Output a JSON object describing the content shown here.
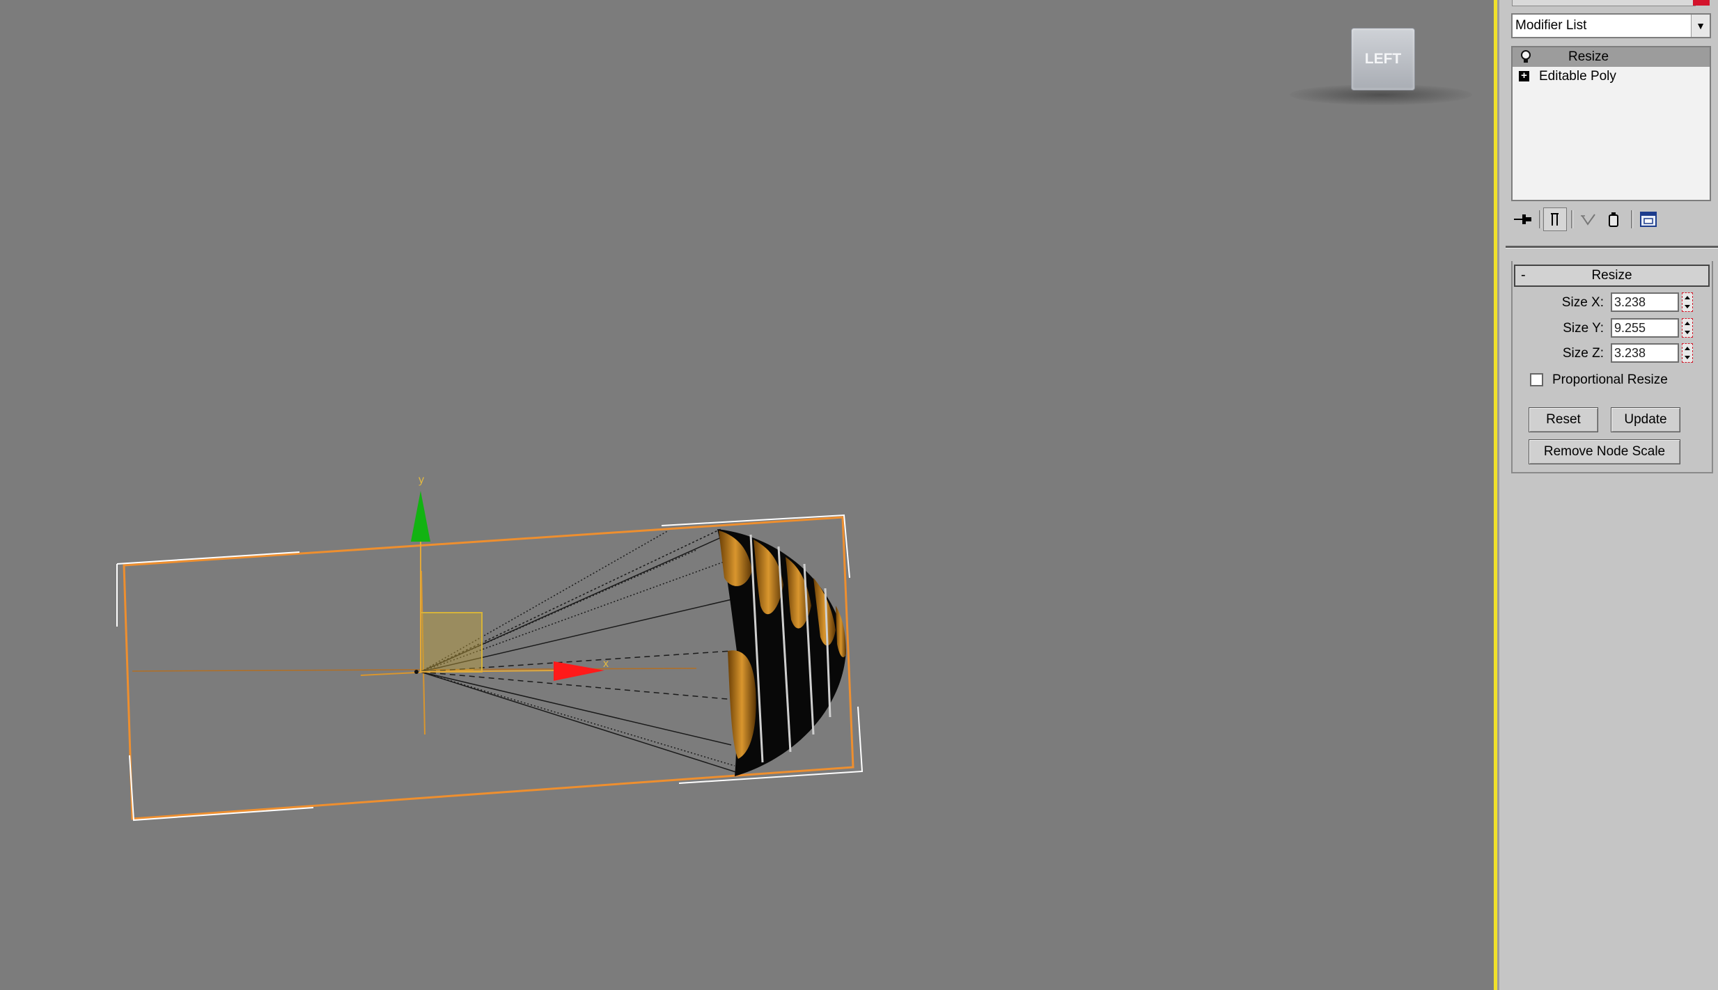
{
  "viewport": {
    "viewcube_label": "LEFT",
    "axis_x_label": "x",
    "axis_y_label": "y",
    "gizmo_x_color": "#ff1a1a",
    "gizmo_y_color": "#12b312",
    "selection_color": "#ee8f2f"
  },
  "command_panel": {
    "modifier_list": {
      "selected": "Modifier List",
      "arrow": "▼"
    },
    "stack": {
      "items": [
        {
          "label": "Resize",
          "icon": "lightbulb-icon",
          "selected": true
        },
        {
          "label": "Editable Poly",
          "icon": "expand-plus-icon",
          "selected": false
        }
      ]
    },
    "toolbar": {
      "icons": [
        "pin-stack-icon",
        "show-end-result-icon",
        "make-unique-icon",
        "remove-modifier-icon",
        "configure-modifier-sets-icon"
      ]
    },
    "rollout": {
      "title": "Resize",
      "collapse": "-",
      "params": [
        {
          "label": "Size X:",
          "value": "3.238"
        },
        {
          "label": "Size Y:",
          "value": "9.255"
        },
        {
          "label": "Size Z:",
          "value": "3.238"
        }
      ],
      "proportional_resize_label": "Proportional Resize",
      "proportional_resize_checked": false,
      "buttons": {
        "reset": "Reset",
        "update": "Update",
        "remove_node_scale": "Remove Node Scale"
      }
    }
  }
}
